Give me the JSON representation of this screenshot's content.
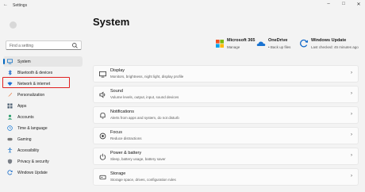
{
  "window": {
    "app_title": "Settings",
    "back_glyph": "←",
    "controls": {
      "minimize": "–",
      "maximize": "□",
      "close": "✕"
    }
  },
  "search": {
    "placeholder": "Find a setting"
  },
  "sidebar": {
    "items": [
      {
        "label": "System",
        "icon": "system-icon",
        "active": true
      },
      {
        "label": "Bluetooth & devices",
        "icon": "bluetooth-icon"
      },
      {
        "label": "Network & internet",
        "icon": "wifi-icon",
        "highlighted": true
      },
      {
        "label": "Personalization",
        "icon": "brush-icon"
      },
      {
        "label": "Apps",
        "icon": "apps-icon"
      },
      {
        "label": "Accounts",
        "icon": "person-icon"
      },
      {
        "label": "Time & language",
        "icon": "globe-clock-icon"
      },
      {
        "label": "Gaming",
        "icon": "gamepad-icon"
      },
      {
        "label": "Accessibility",
        "icon": "accessibility-icon"
      },
      {
        "label": "Privacy & security",
        "icon": "shield-icon"
      },
      {
        "label": "Windows Update",
        "icon": "update-icon"
      }
    ]
  },
  "main": {
    "title": "System",
    "tiles": [
      {
        "title": "Microsoft 365",
        "sub": "Manage",
        "icon": "microsoft-365-icon"
      },
      {
        "title": "OneDrive",
        "sub": "• Back up files",
        "icon": "onedrive-icon"
      },
      {
        "title": "Windows Update",
        "sub": "Last checked: 45 minutes ago",
        "icon": "windows-update-icon"
      }
    ],
    "cards": [
      {
        "title": "Display",
        "sub": "Monitors, brightness, night light, display profile",
        "icon": "display-icon"
      },
      {
        "title": "Sound",
        "sub": "Volume levels, output, input, sound devices",
        "icon": "sound-icon"
      },
      {
        "title": "Notifications",
        "sub": "Alerts from apps and system, do not disturb",
        "icon": "notifications-icon"
      },
      {
        "title": "Focus",
        "sub": "Reduce distractions",
        "icon": "focus-icon"
      },
      {
        "title": "Power & battery",
        "sub": "Sleep, battery usage, battery saver",
        "icon": "power-icon"
      },
      {
        "title": "Storage",
        "sub": "Storage space, drives, configuration rules",
        "icon": "storage-icon"
      }
    ],
    "chevron": "›"
  },
  "colors": {
    "accent": "#0067c0",
    "highlight_border": "#e02020"
  }
}
